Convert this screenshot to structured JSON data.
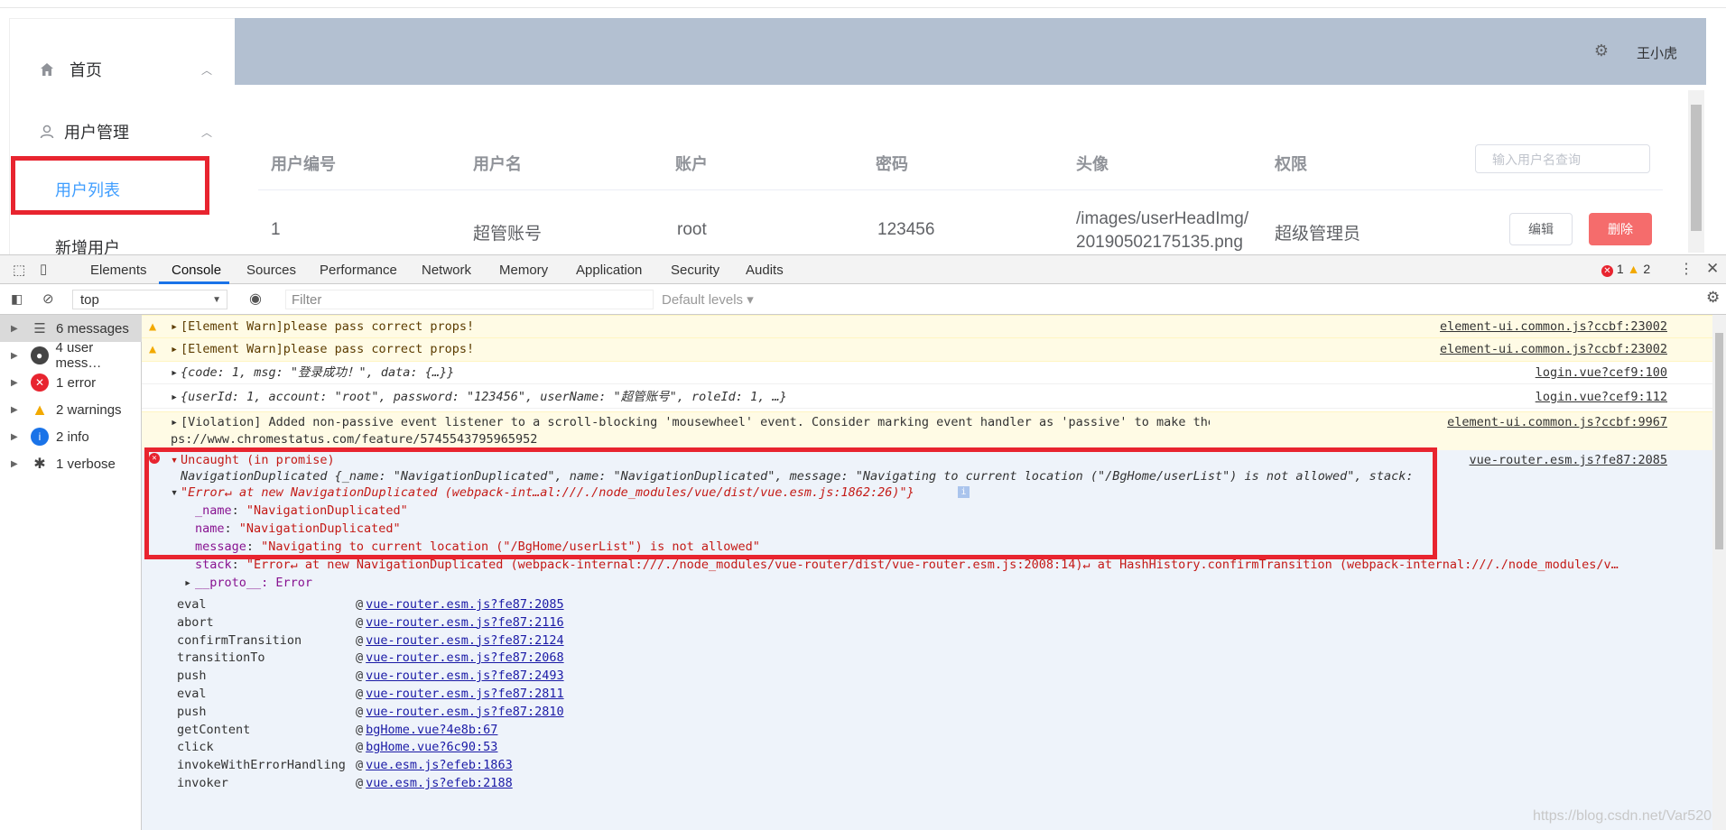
{
  "app": {
    "sidebar": {
      "items": [
        {
          "label": "首页",
          "icon": "home-icon"
        },
        {
          "label": "用户管理",
          "icon": "user-icon"
        }
      ],
      "sub_items": [
        {
          "label": "用户列表",
          "active": true
        },
        {
          "label": "新增用户",
          "active": false
        }
      ]
    },
    "header": {
      "username": "王小虎",
      "icon": "gear-icon",
      "bg_color": "#b3c0d1"
    },
    "table": {
      "columns": [
        "用户编号",
        "用户名",
        "账户",
        "密码",
        "头像",
        "权限"
      ],
      "rows": [
        {
          "id": "1",
          "username": "超管账号",
          "account": "root",
          "password": "123456",
          "avatar_line1": "/images/userHeadImg/",
          "avatar_line2": "20190502175135.png",
          "role": "超级管理员"
        }
      ],
      "search_placeholder": "输入用户名查询",
      "edit_label": "编辑",
      "delete_label": "删除"
    }
  },
  "devtools": {
    "tabs": [
      "Elements",
      "Console",
      "Sources",
      "Performance",
      "Network",
      "Memory",
      "Application",
      "Security",
      "Audits"
    ],
    "active_tab": "Console",
    "error_count": "1",
    "warning_count": "2",
    "context": "top",
    "filter_placeholder": "Filter",
    "levels": "Default levels ▾",
    "side": [
      {
        "label": "6 messages",
        "icon": "list-icon"
      },
      {
        "label": "4 user mess…",
        "icon": "user-icon"
      },
      {
        "label": "1 error",
        "icon": "error-icon"
      },
      {
        "label": "2 warnings",
        "icon": "warning-icon"
      },
      {
        "label": "2 info",
        "icon": "info-icon"
      },
      {
        "label": "1 verbose",
        "icon": "bug-icon"
      }
    ],
    "messages": {
      "warn1": "[Element Warn]please pass correct props!",
      "warn1_src": "element-ui.common.js?ccbf:23002",
      "warn2": "[Element Warn]please pass correct props!",
      "warn2_src": "element-ui.common.js?ccbf:23002",
      "log1": "{code: 1, msg: \"登录成功！\", data: {…}}",
      "log1_src": "login.vue?cef9:100",
      "log2": "{userId: 1, account: \"root\", password: \"123456\", userName: \"超管账号\", roleId: 1, …}",
      "log2_src": "login.vue?cef9:112",
      "violation1": "[Violation] Added non-passive event listener to a scroll-blocking 'mousewheel' event. Consider marking event handler as 'passive' to make the page more responsive. See htt",
      "violation2": "ps://www.chromestatus.com/feature/5745543795965952",
      "violation_src": "element-ui.common.js?ccbf:9967",
      "err_title": "Uncaught (in promise)",
      "err_src": "vue-router.esm.js?fe87:2085",
      "err_obj1": "NavigationDuplicated {_name: \"NavigationDuplicated\", name: \"NavigationDuplicated\", message: \"Navigating to current location (\"/BgHome/userList\") is not allowed\", stack:",
      "err_obj2": "\"Error↵    at new NavigationDuplicated (webpack-int…al:///./node_modules/vue/dist/vue.esm.js:1862:26)\"}",
      "prop_name_key": "_name",
      "prop_name_val": "\"NavigationDuplicated\"",
      "prop_name2_key": "name",
      "prop_name2_val": "\"NavigationDuplicated\"",
      "prop_msg_key": "message",
      "prop_msg_val": "\"Navigating to current location (\"/BgHome/userList\") is not allowed\"",
      "prop_stack_key": "stack",
      "prop_stack_val": "\"Error↵    at new NavigationDuplicated (webpack-internal:///./node_modules/vue-router/dist/vue-router.esm.js:2008:14)↵    at HashHistory.confirmTransition (webpack-internal:///./node_modules/v…",
      "prop_proto": "__proto__: Error"
    },
    "stack": [
      {
        "fn": "eval",
        "src": "vue-router.esm.js?fe87:2085"
      },
      {
        "fn": "abort",
        "src": "vue-router.esm.js?fe87:2116"
      },
      {
        "fn": "confirmTransition",
        "src": "vue-router.esm.js?fe87:2124"
      },
      {
        "fn": "transitionTo",
        "src": "vue-router.esm.js?fe87:2068"
      },
      {
        "fn": "push",
        "src": "vue-router.esm.js?fe87:2493"
      },
      {
        "fn": "eval",
        "src": "vue-router.esm.js?fe87:2811"
      },
      {
        "fn": "push",
        "src": "vue-router.esm.js?fe87:2810"
      },
      {
        "fn": "getContent",
        "src": "bgHome.vue?4e8b:67"
      },
      {
        "fn": "click",
        "src": "bgHome.vue?6c90:53"
      },
      {
        "fn": "invokeWithErrorHandling",
        "src": "vue.esm.js?efeb:1863"
      },
      {
        "fn": "invoker",
        "src": "vue.esm.js?efeb:2188"
      }
    ]
  },
  "watermark": "https://blog.csdn.net/Var520"
}
